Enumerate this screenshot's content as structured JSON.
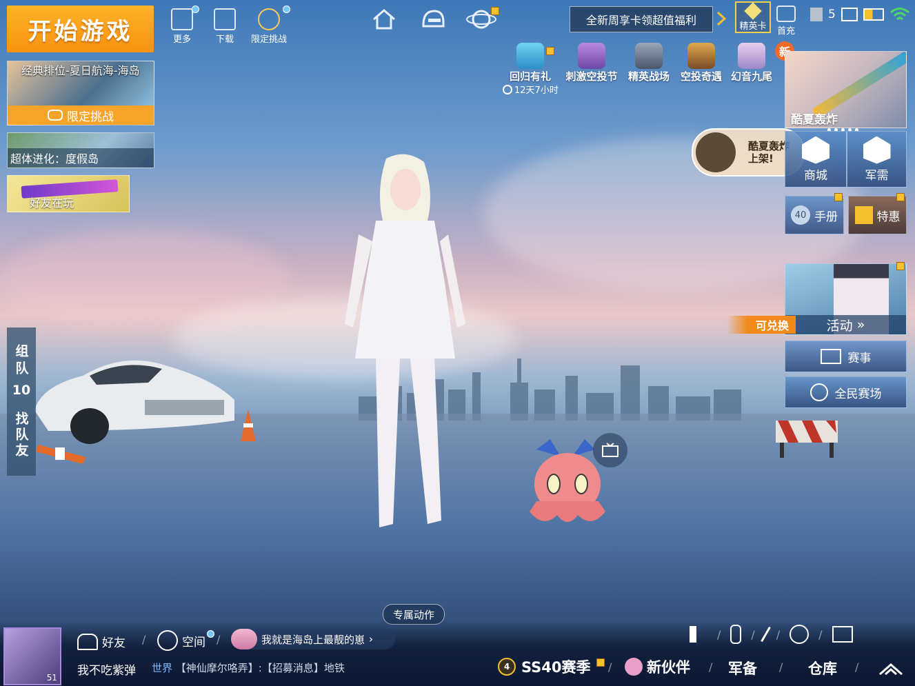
{
  "start_game": "开始游戏",
  "top_nav": [
    {
      "label": "更多",
      "icon": "grid-icon"
    },
    {
      "label": "下载",
      "icon": "download-icon"
    },
    {
      "label": "限定挑战",
      "icon": "badge-icon"
    }
  ],
  "banner_text": "全新周享卡领超值福利",
  "elite_card": "精英卡",
  "first_recharge": "首充",
  "status": {
    "signal": "5"
  },
  "events": [
    {
      "label": "回归有礼"
    },
    {
      "label": "刺激空投节"
    },
    {
      "label": "精英战场"
    },
    {
      "label": "空投奇遇"
    },
    {
      "label": "幻音九尾"
    }
  ],
  "countdown": "12天7小时",
  "new_badge": "新",
  "left_cards": {
    "mode_title": "经典排位-夏日航海-海岛",
    "limited": "限定挑战",
    "evolution": "超体进化：度假岛",
    "friends_playing": "好友在玩"
  },
  "promo": {
    "title": "酷夏轰炸",
    "bubble": "酷夏轰炸上架!",
    "shop": "商城",
    "supply": "军需",
    "handbook_num": "40",
    "handbook": "手册",
    "deal": "特惠",
    "redeem": "可兑换",
    "activity": "活动",
    "match": "赛事",
    "arena": "全民赛场"
  },
  "side_tab": {
    "team": "组队",
    "count": "10",
    "find": "找队友"
  },
  "emote": "专属动作",
  "social": {
    "friends": "好友",
    "space": "空间",
    "broadcast": "我就是海岛上最靓的崽",
    "player_name": "我不吃紫弹",
    "level": "51",
    "chat_channel": "世界",
    "chat_msg": "【神仙摩尔咯弄】:【招募消息】地铁"
  },
  "bottom_nav": {
    "season_level": "4",
    "season": "SS40赛季",
    "partner": "新伙伴",
    "armory": "军备",
    "warehouse": "仓库"
  },
  "colors": {
    "orange": "#f79210",
    "accent_blue": "#78c8ff"
  }
}
